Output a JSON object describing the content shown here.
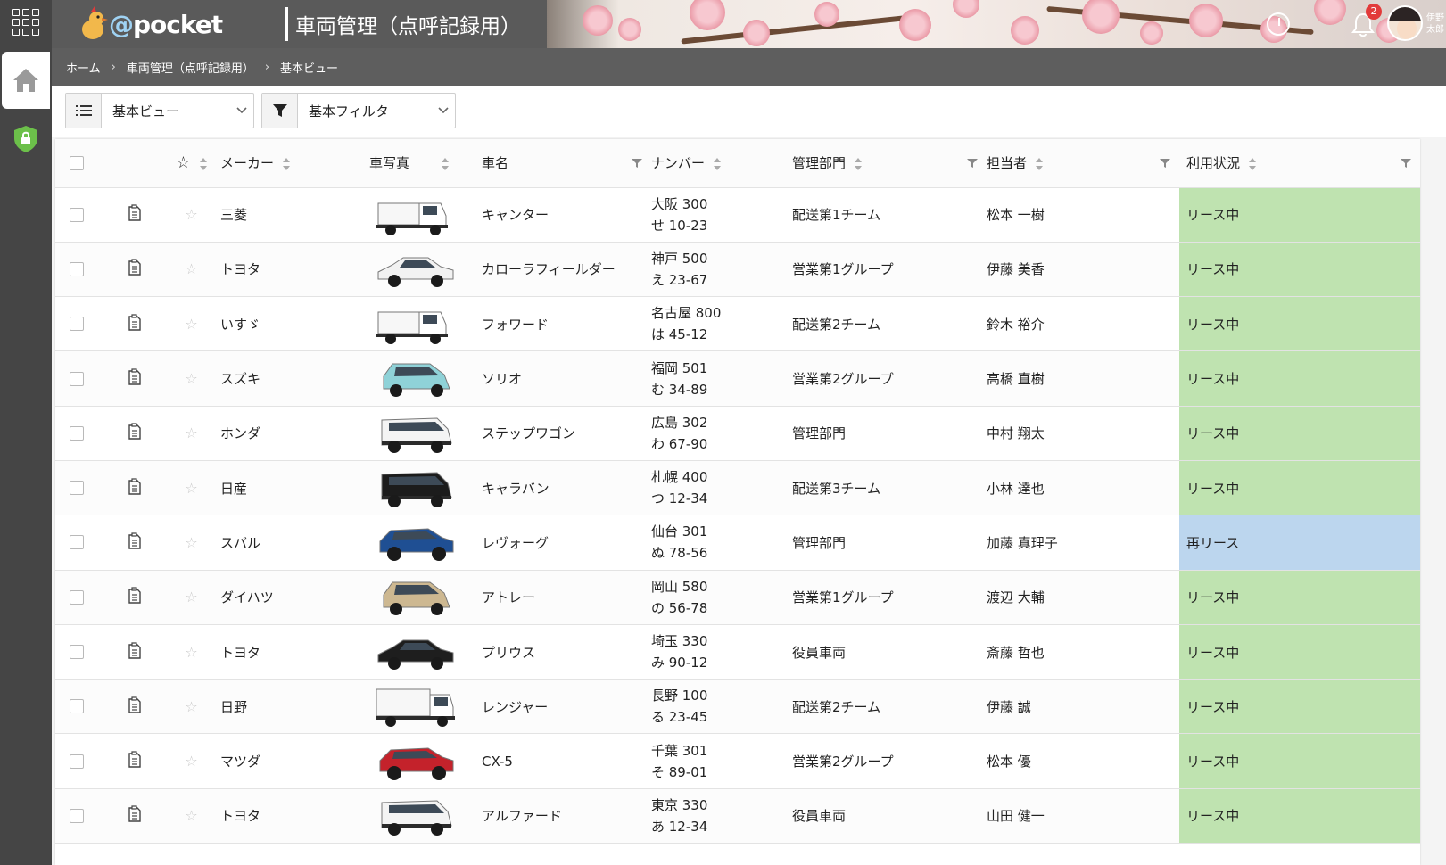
{
  "header": {
    "brand": "@pocket",
    "brand_at": "@",
    "brand_name": "pocket",
    "title": "車両管理（点呼記録用）",
    "notification_count": "2",
    "user_name_line1": "伊野",
    "user_name_line2": "太郎"
  },
  "breadcrumb": [
    "ホーム",
    "車両管理（点呼記録用）",
    "基本ビュー"
  ],
  "toolbar": {
    "view_select": "基本ビュー",
    "filter_select": "基本フィルタ"
  },
  "table": {
    "columns": {
      "maker": "メーカー",
      "photo": "車写真",
      "name": "車名",
      "plate": "ナンバー",
      "dept": "管理部門",
      "owner": "担当者",
      "status": "利用状況"
    },
    "rows": [
      {
        "maker": "三菱",
        "name": "キャンター",
        "plate1": "大阪 300",
        "plate2": "せ 10-23",
        "dept": "配送第1チーム",
        "owner": "松本 一樹",
        "status": "リース中",
        "car": "truck",
        "color": "#ffffff"
      },
      {
        "maker": "トヨタ",
        "name": "カローラフィールダー",
        "plate1": "神戸 500",
        "plate2": "え 23-67",
        "dept": "営業第1グループ",
        "owner": "伊藤 美香",
        "status": "リース中",
        "car": "sedan",
        "color": "#f2f2f2"
      },
      {
        "maker": "いすゞ",
        "name": "フォワード",
        "plate1": "名古屋 800",
        "plate2": "は 45-12",
        "dept": "配送第2チーム",
        "owner": "鈴木 裕介",
        "status": "リース中",
        "car": "truck",
        "color": "#ffffff"
      },
      {
        "maker": "スズキ",
        "name": "ソリオ",
        "plate1": "福岡 501",
        "plate2": "む 34-89",
        "dept": "営業第2グループ",
        "owner": "高橋 直樹",
        "status": "リース中",
        "car": "compact",
        "color": "#8fd2d8"
      },
      {
        "maker": "ホンダ",
        "name": "ステップワゴン",
        "plate1": "広島 302",
        "plate2": "わ 67-90",
        "dept": "管理部門",
        "owner": "中村 翔太",
        "status": "リース中",
        "car": "van",
        "color": "#f4f4f4"
      },
      {
        "maker": "日産",
        "name": "キャラバン",
        "plate1": "札幌 400",
        "plate2": "つ 12-34",
        "dept": "配送第3チーム",
        "owner": "小林 達也",
        "status": "リース中",
        "car": "van",
        "color": "#1c1c1c"
      },
      {
        "maker": "スバル",
        "name": "レヴォーグ",
        "plate1": "仙台 301",
        "plate2": "ぬ 78-56",
        "dept": "管理部門",
        "owner": "加藤 真理子",
        "status": "再リース",
        "car": "suv",
        "color": "#1f4f93"
      },
      {
        "maker": "ダイハツ",
        "name": "アトレー",
        "plate1": "岡山 580",
        "plate2": "の 56-78",
        "dept": "営業第1グループ",
        "owner": "渡辺 大輔",
        "status": "リース中",
        "car": "compact",
        "color": "#cdb891"
      },
      {
        "maker": "トヨタ",
        "name": "プリウス",
        "plate1": "埼玉 330",
        "plate2": "み 90-12",
        "dept": "役員車両",
        "owner": "斎藤 哲也",
        "status": "リース中",
        "car": "sedan",
        "color": "#1e1e1e"
      },
      {
        "maker": "日野",
        "name": "レンジャー",
        "plate1": "長野 100",
        "plate2": "る 23-45",
        "dept": "配送第2チーム",
        "owner": "伊藤 誠",
        "status": "リース中",
        "car": "bigtruck",
        "color": "#ffffff"
      },
      {
        "maker": "マツダ",
        "name": "CX-5",
        "plate1": "千葉 301",
        "plate2": "そ 89-01",
        "dept": "営業第2グループ",
        "owner": "松本 優",
        "status": "リース中",
        "car": "suv",
        "color": "#c4222b"
      },
      {
        "maker": "トヨタ",
        "name": "アルファード",
        "plate1": "東京 330",
        "plate2": "あ 12-34",
        "dept": "役員車両",
        "owner": "山田 健一",
        "status": "リース中",
        "car": "van",
        "color": "#f4f4f4"
      }
    ]
  },
  "colors": {
    "status_lease": "#bfe3b0",
    "status_release": "#bcd6ee",
    "header_bg": "#5a5a5a",
    "rail_bg": "#454545"
  },
  "icons": [
    "apps-grid-icon",
    "home-icon",
    "shield-lock-icon",
    "clock-icon",
    "bell-icon",
    "list-icon",
    "filter-icon",
    "chevron-down-icon",
    "star-icon",
    "document-icon",
    "sort-icon"
  ]
}
